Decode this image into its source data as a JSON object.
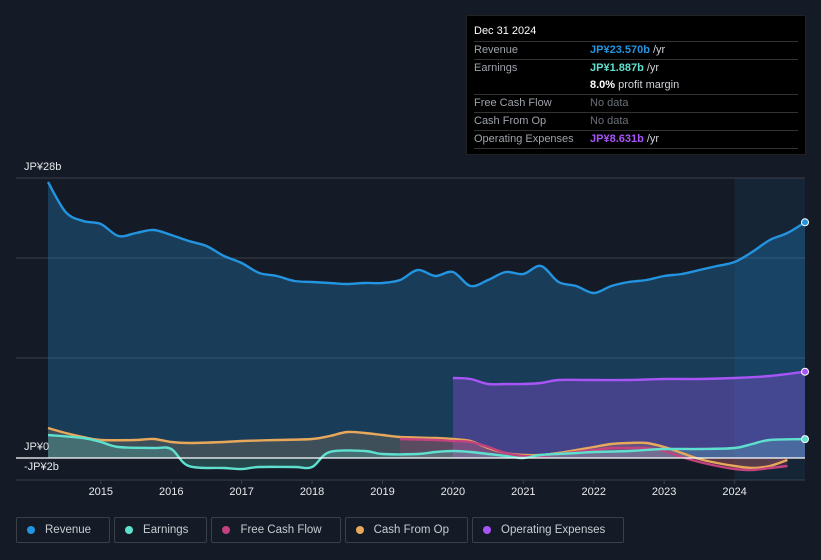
{
  "tooltip": {
    "date": "Dec 31 2024",
    "rows": [
      {
        "label": "Revenue",
        "value": "JP¥23.570b",
        "unit": "/yr",
        "color": "#2394df"
      },
      {
        "label": "Earnings",
        "value": "JP¥1.887b",
        "unit": "/yr",
        "color": "#5fe0cf"
      },
      {
        "label": "",
        "value": "8.0%",
        "unit": "profit margin",
        "color": "#ffffff"
      },
      {
        "label": "Free Cash Flow",
        "value": "No data",
        "unit": "",
        "color": ""
      },
      {
        "label": "Cash From Op",
        "value": "No data",
        "unit": "",
        "color": ""
      },
      {
        "label": "Operating Expenses",
        "value": "JP¥8.631b",
        "unit": "/yr",
        "color": "#a855f7"
      }
    ]
  },
  "legend": [
    {
      "label": "Revenue",
      "color": "#2394df"
    },
    {
      "label": "Earnings",
      "color": "#5fe0cf"
    },
    {
      "label": "Free Cash Flow",
      "color": "#c2427f"
    },
    {
      "label": "Cash From Op",
      "color": "#e8a85b"
    },
    {
      "label": "Operating Expenses",
      "color": "#a855f7"
    }
  ],
  "chart_data": {
    "type": "area",
    "title": "",
    "xlabel": "",
    "ylabel": "",
    "y_tick_labels": [
      "JP¥28b",
      "JP¥0",
      "-JP¥2b"
    ],
    "ylim": [
      -2,
      28
    ],
    "xlim": [
      2014.25,
      2025.0
    ],
    "x_tick_labels": [
      "2015",
      "2016",
      "2017",
      "2018",
      "2019",
      "2020",
      "2021",
      "2022",
      "2023",
      "2024"
    ],
    "grid": true,
    "legend_position": "bottom",
    "highlight_region": [
      2024.0,
      2025.0
    ],
    "series": [
      {
        "name": "Revenue",
        "color": "#2394df",
        "unit": "JP¥b",
        "x": [
          2014.25,
          2014.5,
          2014.75,
          2015.0,
          2015.25,
          2015.5,
          2015.75,
          2016.0,
          2016.25,
          2016.5,
          2016.75,
          2017.0,
          2017.25,
          2017.5,
          2017.75,
          2018.0,
          2018.25,
          2018.5,
          2018.75,
          2019.0,
          2019.25,
          2019.5,
          2019.75,
          2020.0,
          2020.25,
          2020.5,
          2020.75,
          2021.0,
          2021.25,
          2021.5,
          2021.75,
          2022.0,
          2022.25,
          2022.5,
          2022.75,
          2023.0,
          2023.25,
          2023.5,
          2023.75,
          2024.0,
          2024.25,
          2024.5,
          2024.75,
          2025.0
        ],
        "values": [
          27.6,
          24.6,
          23.7,
          23.4,
          22.2,
          22.5,
          22.8,
          22.3,
          21.7,
          21.2,
          20.2,
          19.5,
          18.5,
          18.2,
          17.7,
          17.6,
          17.5,
          17.4,
          17.5,
          17.5,
          17.8,
          18.8,
          18.2,
          18.6,
          17.2,
          17.8,
          18.6,
          18.4,
          19.2,
          17.6,
          17.2,
          16.5,
          17.2,
          17.6,
          17.8,
          18.2,
          18.4,
          18.8,
          19.2,
          19.6,
          20.6,
          21.8,
          22.5,
          23.57
        ]
      },
      {
        "name": "Earnings",
        "color": "#5fe0cf",
        "unit": "JP¥b",
        "x": [
          2014.25,
          2014.75,
          2015.0,
          2015.25,
          2015.75,
          2016.0,
          2016.25,
          2016.75,
          2017.0,
          2017.25,
          2017.75,
          2018.0,
          2018.25,
          2018.75,
          2019.0,
          2019.5,
          2019.75,
          2020.0,
          2020.25,
          2020.75,
          2021.0,
          2021.25,
          2021.75,
          2022.0,
          2022.5,
          2023.0,
          2023.5,
          2024.0,
          2024.25,
          2024.5,
          2025.0
        ],
        "values": [
          2.3,
          2.0,
          1.6,
          1.1,
          1.0,
          0.9,
          -0.8,
          -1.0,
          -1.1,
          -0.9,
          -0.9,
          -0.9,
          0.6,
          0.7,
          0.4,
          0.4,
          0.6,
          0.7,
          0.6,
          0.2,
          0.0,
          0.3,
          0.5,
          0.6,
          0.7,
          0.9,
          0.9,
          1.0,
          1.4,
          1.8,
          1.887
        ]
      },
      {
        "name": "Free Cash Flow",
        "color": "#c2427f",
        "unit": "JP¥b",
        "x": [
          2019.25,
          2019.75,
          2020.0,
          2020.25,
          2020.5,
          2020.75,
          2021.0,
          2021.25,
          2021.5,
          2021.75,
          2022.0,
          2022.25,
          2022.5,
          2022.75,
          2023.0,
          2023.25,
          2023.5,
          2023.75,
          2024.0,
          2024.25,
          2024.5,
          2024.75
        ],
        "values": [
          1.9,
          1.8,
          1.7,
          1.6,
          1.1,
          0.5,
          0.2,
          0.2,
          0.4,
          0.6,
          0.8,
          1.0,
          1.0,
          1.0,
          0.7,
          0.1,
          -0.4,
          -0.8,
          -1.1,
          -1.2,
          -1.0,
          -0.8
        ]
      },
      {
        "name": "Cash From Op",
        "color": "#e8a85b",
        "unit": "JP¥b",
        "x": [
          2014.25,
          2014.5,
          2014.75,
          2015.0,
          2015.5,
          2015.75,
          2016.0,
          2016.25,
          2016.75,
          2017.0,
          2017.5,
          2018.0,
          2018.25,
          2018.5,
          2018.75,
          2019.0,
          2019.25,
          2019.75,
          2020.0,
          2020.25,
          2020.5,
          2020.75,
          2021.0,
          2021.25,
          2021.5,
          2021.75,
          2022.0,
          2022.25,
          2022.5,
          2022.75,
          2023.0,
          2023.25,
          2023.5,
          2023.75,
          2024.0,
          2024.25,
          2024.5,
          2024.75
        ],
        "values": [
          3.0,
          2.5,
          2.1,
          1.8,
          1.8,
          1.9,
          1.6,
          1.5,
          1.6,
          1.7,
          1.8,
          1.9,
          2.2,
          2.6,
          2.5,
          2.3,
          2.1,
          2.0,
          1.9,
          1.7,
          1.0,
          0.5,
          0.3,
          0.3,
          0.5,
          0.8,
          1.1,
          1.4,
          1.5,
          1.5,
          1.1,
          0.5,
          -0.1,
          -0.5,
          -0.8,
          -1.0,
          -0.8,
          -0.2
        ]
      },
      {
        "name": "Operating Expenses",
        "color": "#a855f7",
        "unit": "JP¥b",
        "x": [
          2020.0,
          2020.25,
          2020.5,
          2020.75,
          2021.0,
          2021.25,
          2021.5,
          2022.0,
          2022.5,
          2023.0,
          2023.5,
          2024.0,
          2024.5,
          2025.0
        ],
        "values": [
          8.0,
          7.9,
          7.4,
          7.4,
          7.4,
          7.5,
          7.8,
          7.8,
          7.8,
          7.9,
          7.9,
          8.0,
          8.2,
          8.631
        ]
      }
    ]
  }
}
